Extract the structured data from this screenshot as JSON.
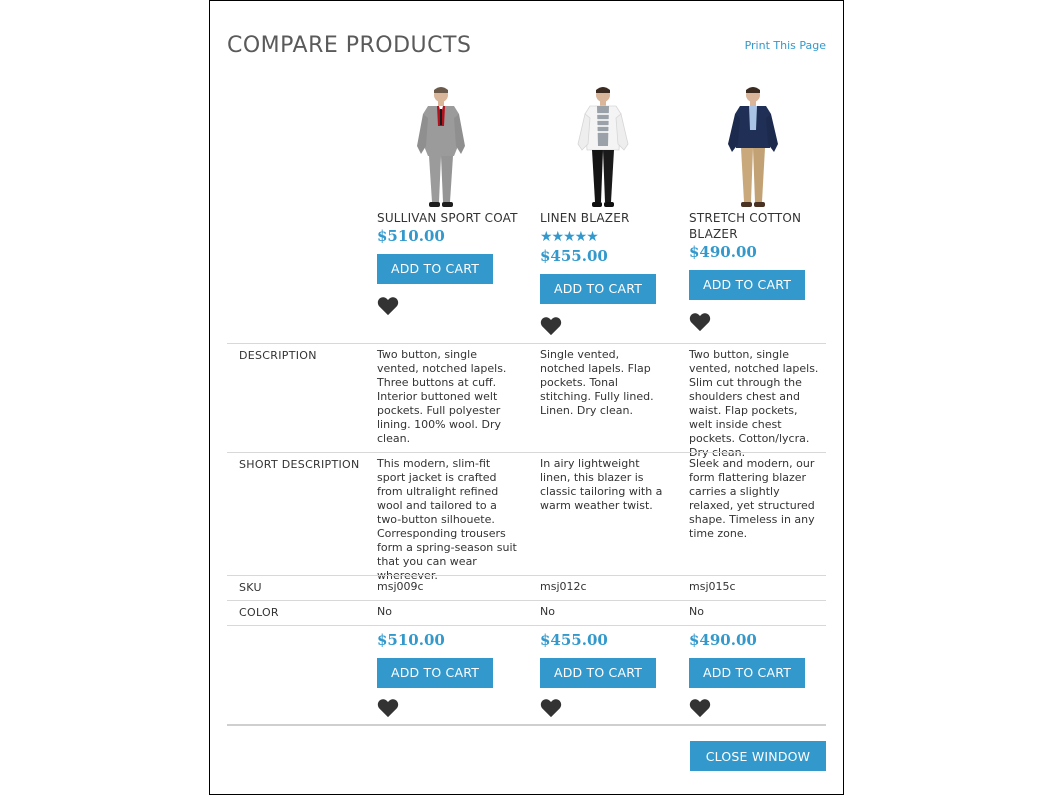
{
  "header": {
    "title": "COMPARE PRODUCTS",
    "print_link": "Print This Page"
  },
  "products": [
    {
      "name": "SULLIVAN SPORT COAT",
      "price": "$510.00",
      "rating_stars": 0,
      "add_to_cart": "ADD TO CART",
      "wishlist_icon": "heart-icon",
      "description": "Two button, single vented, notched lapels. Three buttons at cuff. Interior buttoned welt pockets. Full polyester lining. 100% wool. Dry clean.",
      "short_description": "This modern, slim-fit sport jacket is crafted from ultralight refined wool and tailored to a two-button silhouete. Corresponding trousers form a spring-season suit that you can wear whereever.",
      "sku": "msj009c",
      "color": "No",
      "bottom_price": "$510.00",
      "bottom_add_to_cart": "ADD TO CART"
    },
    {
      "name": "LINEN BLAZER",
      "price": "$455.00",
      "rating_stars": 5,
      "rating_display": "★★★★★",
      "add_to_cart": "ADD TO CART",
      "wishlist_icon": "heart-icon",
      "description": "Single vented, notched lapels. Flap pockets. Tonal stitching. Fully lined. Linen. Dry clean.",
      "short_description": "In airy lightweight linen, this blazer is classic tailoring with a warm weather twist.",
      "sku": "msj012c",
      "color": "No",
      "bottom_price": "$455.00",
      "bottom_add_to_cart": "ADD TO CART"
    },
    {
      "name": "STRETCH COTTON BLAZER",
      "price": "$490.00",
      "rating_stars": 0,
      "add_to_cart": "ADD TO CART",
      "wishlist_icon": "heart-icon",
      "description": "Two button, single vented, notched lapels. Slim cut through the shoulders chest and waist. Flap pockets, welt inside chest pockets. Cotton/lycra. Dry clean.",
      "short_description": "Sleek and modern, our form flattering blazer carries a slightly relaxed, yet structured shape. Timeless in any time zone.",
      "sku": "msj015c",
      "color": "No",
      "bottom_price": "$490.00",
      "bottom_add_to_cart": "ADD TO CART"
    }
  ],
  "rows": {
    "description": "DESCRIPTION",
    "short_description": "SHORT DESCRIPTION",
    "sku": "SKU",
    "color": "COLOR"
  },
  "footer": {
    "close_button": "CLOSE WINDOW"
  },
  "colors": {
    "accent": "#3399cc",
    "heart": "#333333",
    "divider": "#d8d8d8"
  }
}
